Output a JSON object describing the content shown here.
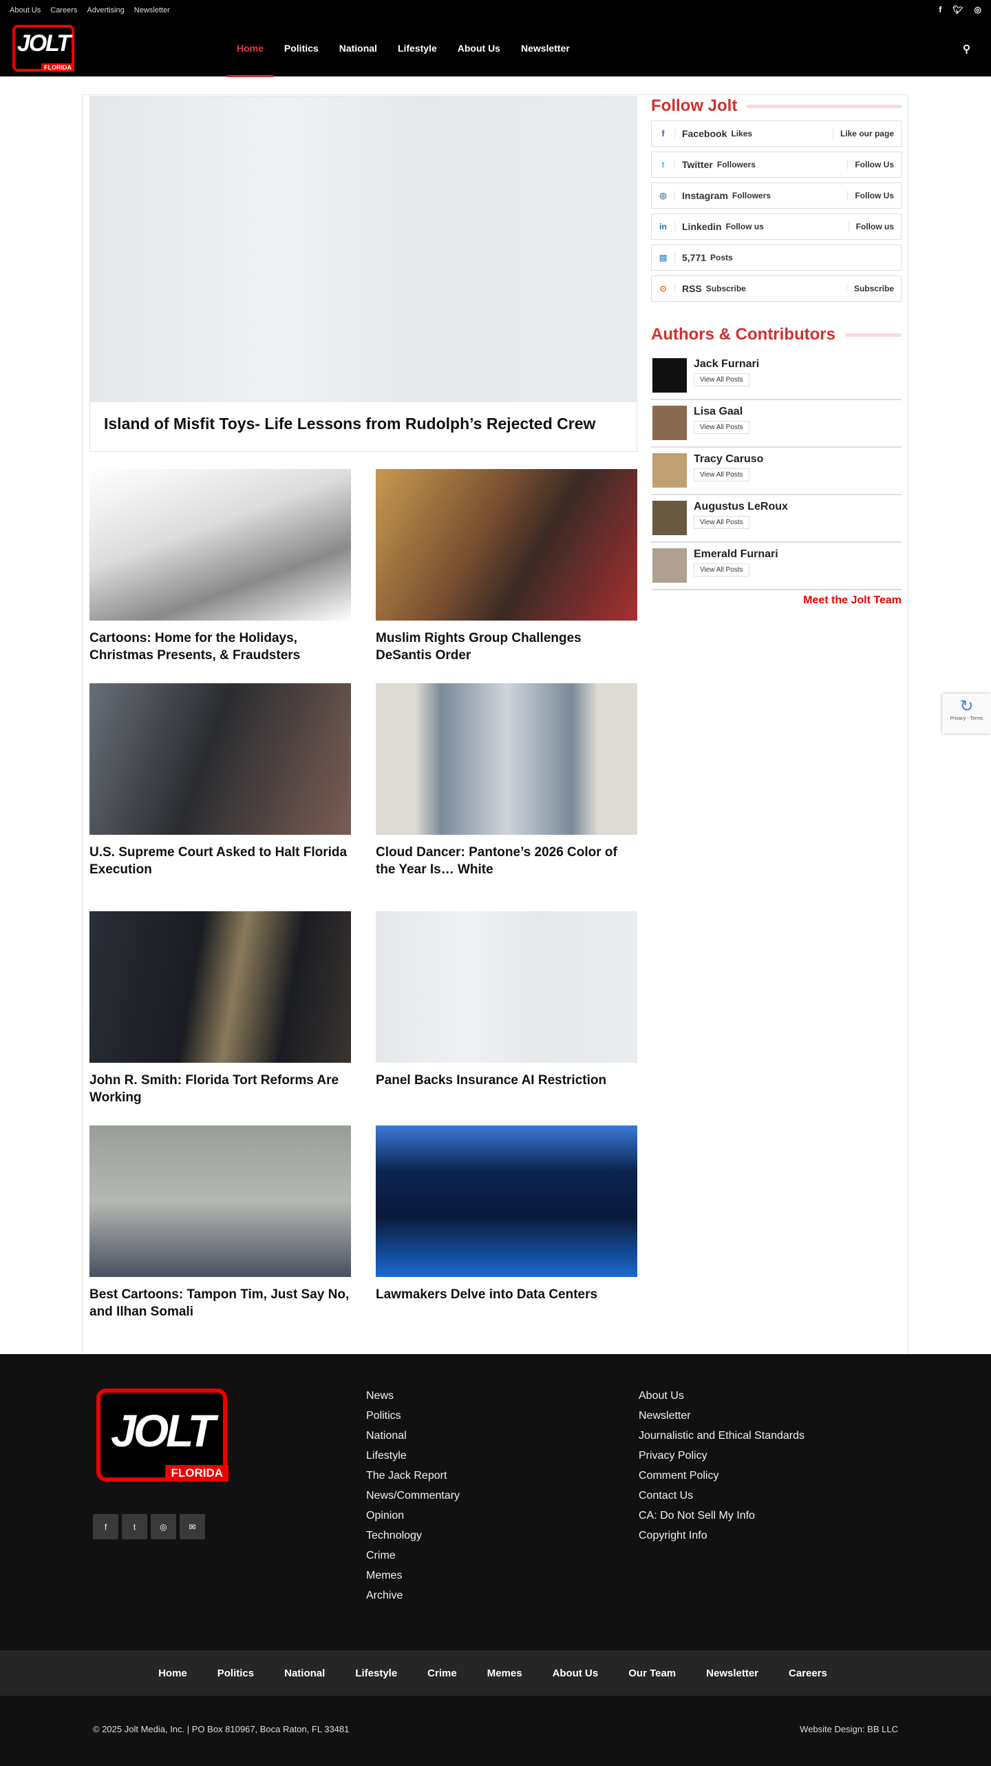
{
  "topbar": {
    "links": [
      "About Us",
      "Careers",
      "Advertising",
      "Newsletter"
    ],
    "social": [
      "f",
      "t",
      "ig"
    ]
  },
  "logo": {
    "text": "JOLT",
    "sub": "FLORIDA"
  },
  "nav": {
    "items": [
      "Home",
      "Politics",
      "National",
      "Lifestyle",
      "About Us",
      "Newsletter"
    ],
    "active": "Home"
  },
  "hero": {
    "title": "Island of Misfit Toys- Life Lessons from Rudolph’s Rejected Crew"
  },
  "articles": [
    {
      "title": "Cartoons: Home for the Holidays, Christmas Presents, & Fraudsters"
    },
    {
      "title": "Muslim Rights Group Challenges DeSantis Order"
    },
    {
      "title": "U.S. Supreme Court Asked to Halt Florida Execution"
    },
    {
      "title": "Cloud Dancer: Pantone’s 2026 Color of the Year Is… White"
    },
    {
      "title": "John R. Smith: Florida Tort Reforms Are Working"
    },
    {
      "title": "Panel Backs Insurance AI Restriction"
    },
    {
      "title": "Best Cartoons: Tampon Tim, Just Say No, and Ilhan Somali"
    },
    {
      "title": "Lawmakers Delve into Data Centers"
    }
  ],
  "follow": {
    "title": "Follow Jolt",
    "items": [
      {
        "icon": "f",
        "name": "Facebook",
        "sub": "Likes",
        "action": "Like our page",
        "color": "#3b5998"
      },
      {
        "icon": "t",
        "name": "Twitter",
        "sub": "Followers",
        "action": "Follow Us",
        "color": "#55acee"
      },
      {
        "icon": "◎",
        "name": "Instagram",
        "sub": "Followers",
        "action": "Follow Us",
        "color": "#3f729b"
      },
      {
        "icon": "in",
        "name": "Linkedin",
        "sub": "Follow us",
        "action": "Follow us",
        "color": "#0077b5"
      },
      {
        "icon": "▤",
        "name": "5,771",
        "sub": "Posts",
        "action": "",
        "color": "#4a90d9"
      },
      {
        "icon": "⊙",
        "name": "RSS",
        "sub": "Subscribe",
        "action": "Subscribe",
        "color": "#f26522"
      }
    ]
  },
  "authors": {
    "title": "Authors & Contributors",
    "button": "View All Posts",
    "items": [
      "Jack Furnari",
      "Lisa Gaal",
      "Tracy Caruso",
      "Augustus LeRoux",
      "Emerald Furnari"
    ],
    "more": "Meet the Jolt Team"
  },
  "recaptcha": {
    "text": "Privacy - Terms"
  },
  "footer": {
    "col1": [
      "News",
      "Politics",
      "National",
      "Lifestyle",
      "The Jack Report",
      "News/Commentary",
      "Opinion",
      "Technology",
      "Crime",
      "Memes",
      "Archive"
    ],
    "col2": [
      "About Us",
      "Newsletter",
      "Journalistic and Ethical Standards",
      "Privacy Policy",
      "Comment Policy",
      "Contact Us",
      "CA: Do Not Sell My Info",
      "Copyright Info"
    ],
    "social": [
      "f",
      "t",
      "◎",
      "✉"
    ],
    "bottom_nav": [
      "Home",
      "Politics",
      "National",
      "Lifestyle",
      "Crime",
      "Memes",
      "About Us",
      "Our Team",
      "Newsletter",
      "Careers"
    ],
    "copyright": "© 2025 Jolt Media, Inc. | PO Box 810967, Boca Raton, FL 33481",
    "design": "Website Design: BB LLC"
  }
}
